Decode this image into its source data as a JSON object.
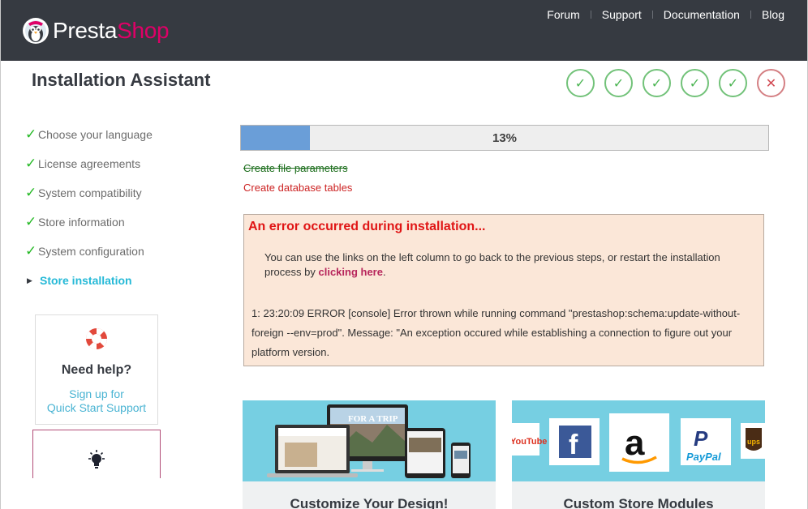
{
  "header": {
    "logo_prefix": "Presta",
    "logo_suffix": "Shop",
    "nav": [
      "Forum",
      "Support",
      "Documentation",
      "Blog"
    ]
  },
  "page_title": "Installation Assistant",
  "steps": {
    "check_glyph": "✓",
    "error_glyph": "✕",
    "states": [
      "done",
      "done",
      "done",
      "done",
      "done",
      "error"
    ]
  },
  "sidebar": {
    "items": [
      {
        "label": "Choose your language"
      },
      {
        "label": "License agreements"
      },
      {
        "label": "System compatibility"
      },
      {
        "label": "Store information"
      },
      {
        "label": "System configuration"
      },
      {
        "label": "Store installation"
      }
    ],
    "check_glyph": "✓",
    "active_glyph": "▶"
  },
  "help": {
    "title": "Need help?",
    "link_line1": "Sign up for",
    "link_line2": "Quick Start Support"
  },
  "progress": {
    "value_percent": 13,
    "label": "13%"
  },
  "tasks": {
    "done": "Create file parameters",
    "failed": "Create database tables"
  },
  "error": {
    "title": "An error occurred during installation...",
    "text_before": "You can use the links on the left column to go back to the previous steps, or restart the installation process by ",
    "link": "clicking here",
    "text_after": ".",
    "log": "1: 23:20:09 ERROR [console] Error thrown while running command \"prestashop:schema:update-without-foreign --env=prod\". Message: \"An exception occured while establishing a connection to figure out your platform version."
  },
  "cards": [
    {
      "title": "Customize Your Design!",
      "banner": "FOR A TRIP"
    },
    {
      "title": "Custom Store Modules",
      "brands": [
        "YouTube",
        "f",
        "a",
        "PayPal",
        "ups"
      ]
    }
  ],
  "colors": {
    "header_bg": "#363a41",
    "brand_pink": "#df0067",
    "accent_blue": "#25b9d7",
    "success_green": "#25b925",
    "error_red": "#e01515",
    "progress_fill": "#6a9ed8"
  }
}
